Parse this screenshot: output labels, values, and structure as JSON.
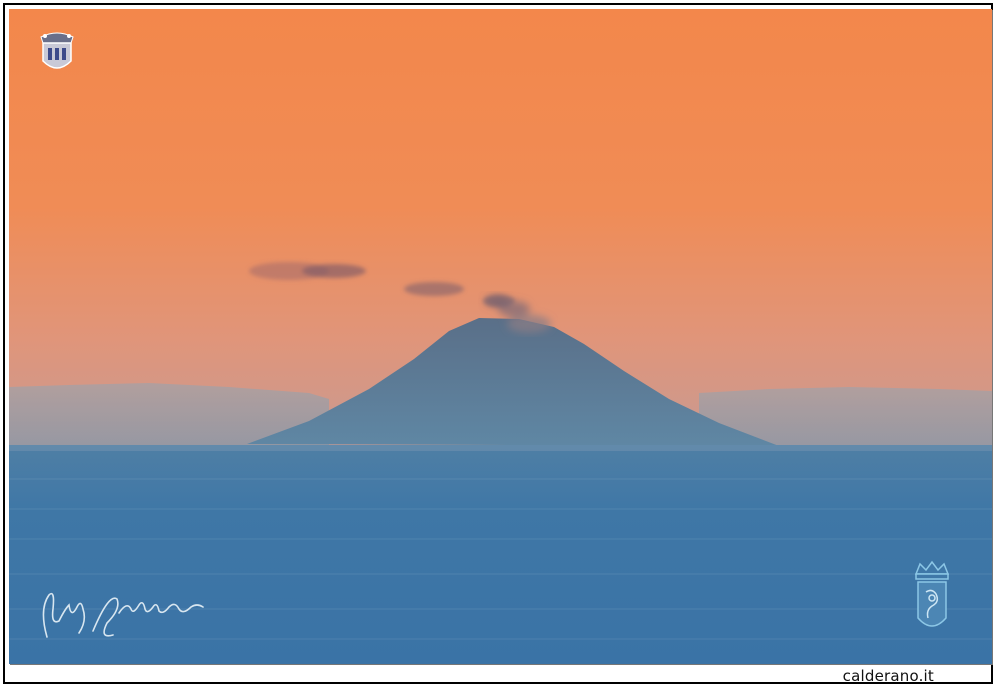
{
  "footer": {
    "site": "calderano.it"
  },
  "watermarks": {
    "top_left_crest": "crest-icon",
    "bottom_right_crest": "crest-icon",
    "signature": "signature-mark"
  },
  "colors": {
    "sky_top": "#f4884c",
    "sky_horizon": "#d89a80",
    "haze": "#9aa3ab",
    "volcano": "#5d7b94",
    "sea": "#3f78a8",
    "watermark_blue": "#8cc7e6"
  }
}
